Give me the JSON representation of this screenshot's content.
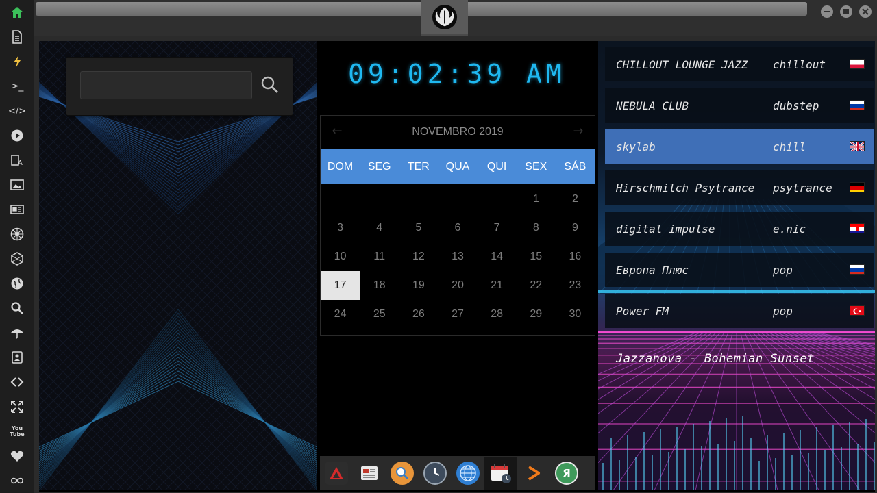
{
  "sidebar": {
    "icons": [
      "home-icon",
      "document-icon",
      "lightning-icon",
      "terminal-icon",
      "code-icon",
      "play-icon",
      "translate-icon",
      "image-icon",
      "news-icon",
      "empire-icon",
      "hexagon-icon",
      "globe-icon",
      "search-icon",
      "umbrella-icon",
      "contacts-icon",
      "link-icon",
      "expand-icon",
      "youtube-icon",
      "heart-icon",
      "infinity-icon"
    ],
    "terminal_glyph": ">_",
    "code_glyph": "</>",
    "youtube_label": "You Tube"
  },
  "search": {
    "placeholder": ""
  },
  "clock": {
    "time": "09:02:39 AM"
  },
  "calendar": {
    "month_label": "NOVEMBRO 2019",
    "day_names": [
      "DOM",
      "SEG",
      "TER",
      "QUA",
      "QUI",
      "SEX",
      "SÁB"
    ],
    "weeks": [
      [
        "",
        "",
        "",
        "",
        "",
        "1",
        "2"
      ],
      [
        "3",
        "4",
        "5",
        "6",
        "7",
        "8",
        "9"
      ],
      [
        "10",
        "11",
        "12",
        "13",
        "14",
        "15",
        "16"
      ],
      [
        "17",
        "18",
        "19",
        "20",
        "21",
        "22",
        "23"
      ],
      [
        "24",
        "25",
        "26",
        "27",
        "28",
        "29",
        "30"
      ]
    ],
    "today": "17",
    "prev_glyph": "←",
    "next_glyph": "→"
  },
  "dock": {
    "items": [
      "app-launcher-icon",
      "news-reader-icon",
      "search-app-icon",
      "clock-app-icon",
      "browser-icon",
      "calendar-app-icon",
      "terminal-app-icon",
      "yandex-icon"
    ],
    "yandex_glyph": "Я",
    "active_index": 5
  },
  "radio": {
    "stations": [
      {
        "name": "CHILLOUT LOUNGE JAZZ",
        "genre": "chillout",
        "flag": "poland"
      },
      {
        "name": "NEBULA CLUB",
        "genre": "dubstep",
        "flag": "russia"
      },
      {
        "name": "skylab",
        "genre": "chill",
        "flag": "uk"
      },
      {
        "name": "Hirschmilch Psytrance",
        "genre": "psytrance",
        "flag": "germany"
      },
      {
        "name": "digital impulse",
        "genre": "e.nic",
        "flag": "croatia"
      },
      {
        "name": "Европа Плюс",
        "genre": "pop",
        "flag": "russia"
      },
      {
        "name": "Power FM",
        "genre": "pop",
        "flag": "turkey"
      }
    ],
    "selected_index": 2,
    "now_playing": "Jazzanova - Bohemian Sunset"
  },
  "colors": {
    "accent_blue": "#4a8bd8",
    "clock_cyan": "#1fb8f0",
    "selected_station": "#3f6fb7",
    "home_green": "#3cc05a"
  }
}
